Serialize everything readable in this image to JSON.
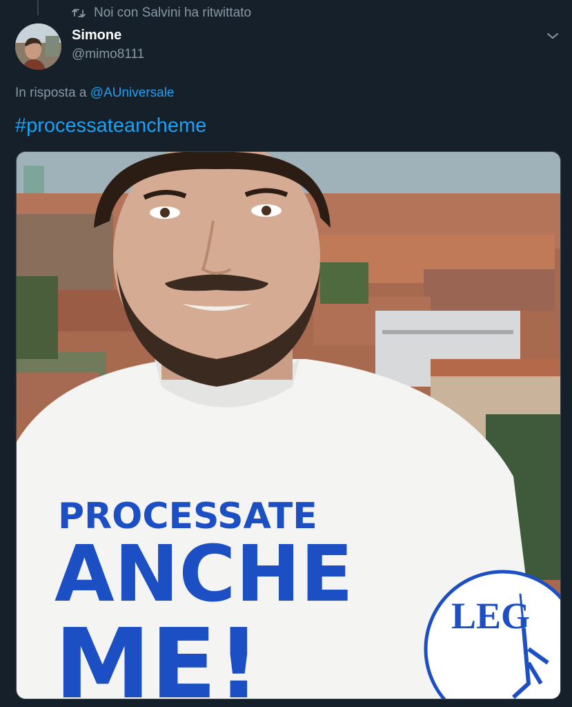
{
  "retweet": {
    "label": "Noi con Salvini ha ritwittato",
    "icon": "retweet-icon"
  },
  "author": {
    "name": "Simone",
    "handle": "@mimo8111"
  },
  "reply": {
    "prefix": "In risposta a",
    "target": "@AUniversale"
  },
  "tweet": {
    "hashtag": "#processateancheme"
  },
  "media": {
    "shirt_line1": "PROCESSATE",
    "shirt_line2": "ANCHE",
    "shirt_line3": "ME!",
    "logo_text": "LEG"
  },
  "colors": {
    "background": "#15202b",
    "link": "#1da1f2",
    "secondary_text": "#8899a6",
    "shirt_print": "#1d4fc4"
  }
}
